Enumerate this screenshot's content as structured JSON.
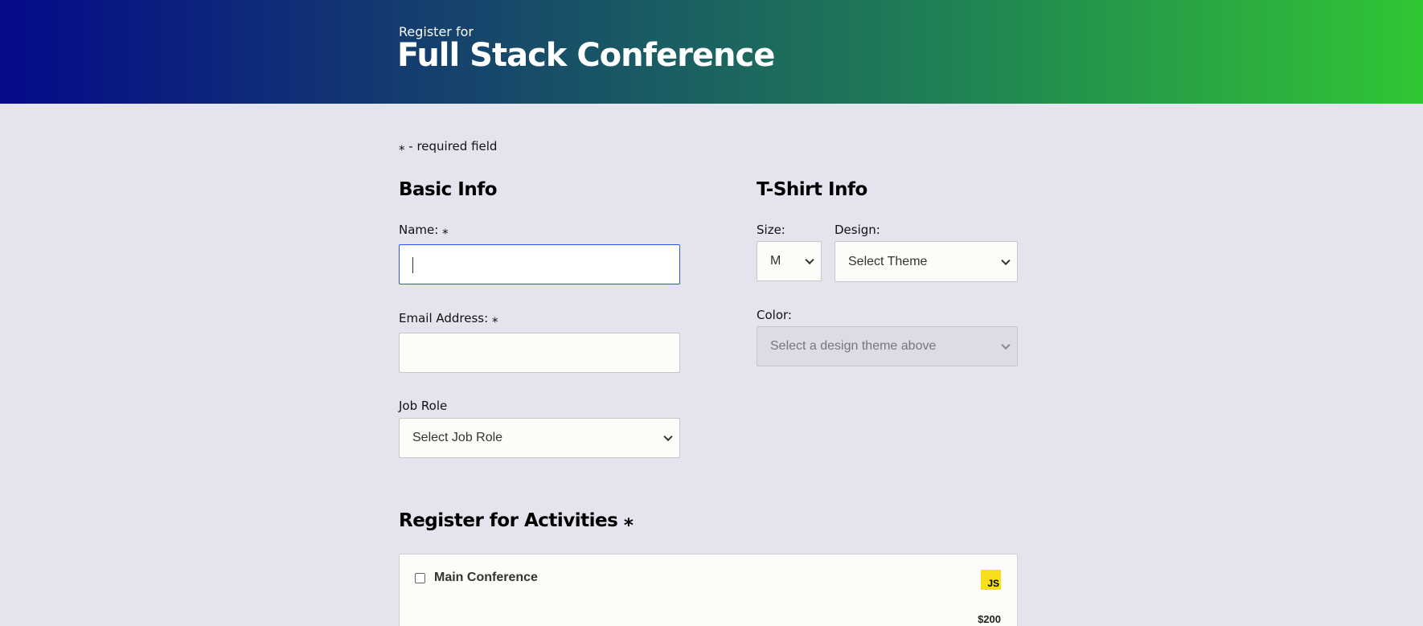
{
  "header": {
    "subtitle": "Register for",
    "title": "Full Stack Conference"
  },
  "required_note": "⁎ - required field",
  "basic_info": {
    "title": "Basic Info",
    "name_label": "Name: ⁎",
    "name_value": "",
    "email_label": "Email Address: ⁎",
    "email_value": "",
    "job_role_label": "Job Role",
    "job_role_selected": "Select Job Role"
  },
  "tshirt_info": {
    "title": "T-Shirt Info",
    "size_label": "Size:",
    "size_selected": "M",
    "design_label": "Design:",
    "design_selected": "Select Theme",
    "color_label": "Color:",
    "color_selected": "Select a design theme above"
  },
  "activities": {
    "title": "Register for Activities ⁎",
    "items": [
      {
        "name": "Main Conference",
        "icon": "js-icon",
        "icon_text": "JS",
        "price": "$200",
        "checked": false
      }
    ]
  },
  "colors": {
    "gradient_start": "#050a8a",
    "gradient_end": "#31c634",
    "page_background": "#e4e4ef",
    "focus_border": "#2b55e6",
    "js_yellow": "#f7df1e"
  }
}
